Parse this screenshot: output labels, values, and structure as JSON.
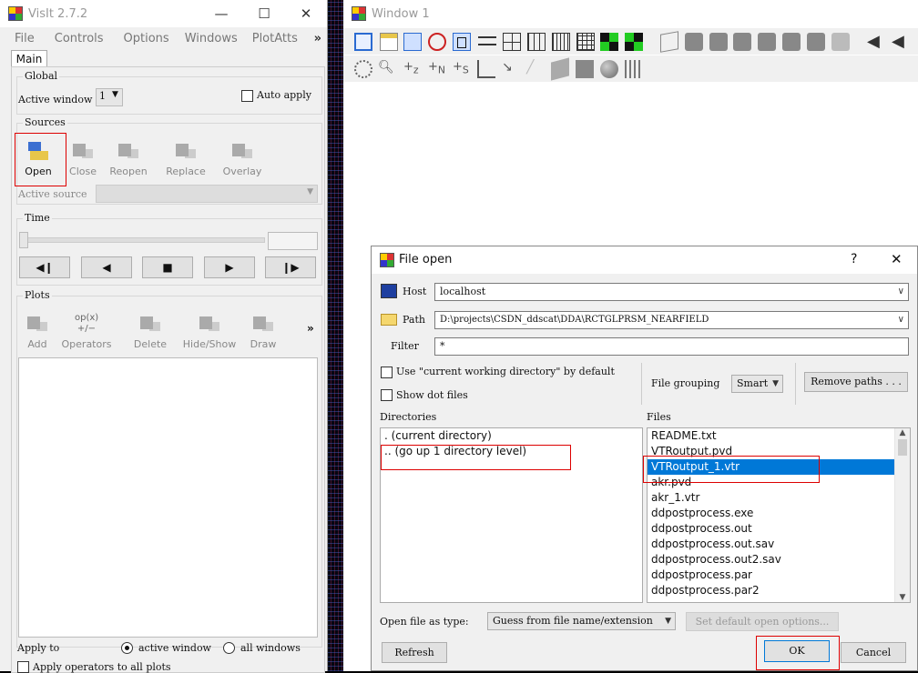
{
  "visit": {
    "title": "VisIt 2.7.2",
    "window_controls": {
      "minimize": "—",
      "maximize": "☐",
      "close": "✕"
    },
    "menu": [
      "File",
      "Controls",
      "Options",
      "Windows",
      "PlotAtts"
    ],
    "menu_more": "»",
    "tab": "Main",
    "global": {
      "title": "Global",
      "active_window_label": "Active window",
      "active_window_value": "1",
      "auto_apply_label": "Auto apply"
    },
    "sources": {
      "title": "Sources",
      "buttons": [
        "Open",
        "Close",
        "Reopen",
        "Replace",
        "Overlay"
      ],
      "active_source_label": "Active source"
    },
    "time": {
      "title": "Time",
      "buttons": [
        "◀❙",
        "◀",
        "■",
        "▶",
        "❙▶"
      ]
    },
    "plots": {
      "title": "Plots",
      "buttons": [
        "Add",
        "Operators",
        "Delete",
        "Hide/Show",
        "Draw"
      ],
      "more": "»"
    },
    "apply_to": {
      "label": "Apply to",
      "opt_active": "active window",
      "opt_all": "all windows",
      "apply_ops": "Apply operators to all plots"
    }
  },
  "window1": {
    "title": "Window 1"
  },
  "dialog": {
    "title": "File open",
    "help": "?",
    "close": "✕",
    "host_label": "Host",
    "host_value": "localhost",
    "path_label": "Path",
    "path_value": "D:\\projects\\CSDN_ddscat\\DDA\\RCTGLPRSM_NEARFIELD",
    "filter_label": "Filter",
    "filter_value": "*",
    "use_cwd_label": "Use \"current working directory\" by default",
    "show_dot_label": "Show dot files",
    "file_grouping_label": "File grouping",
    "file_grouping_value": "Smart",
    "remove_paths_label": "Remove paths . . .",
    "directories_label": "Directories",
    "directories": [
      ". (current directory)",
      ".. (go up 1 directory level)"
    ],
    "files_label": "Files",
    "files": [
      "README.txt",
      "VTRoutput.pvd",
      "VTRoutput_1.vtr",
      "akr.pvd",
      "akr_1.vtr",
      "ddpostprocess.exe",
      "ddpostprocess.out",
      "ddpostprocess.out.sav",
      "ddpostprocess.out2.sav",
      "ddpostprocess.par",
      "ddpostprocess.par2"
    ],
    "selected_file": "VTRoutput_1.vtr",
    "open_as_label": "Open file as type:",
    "open_as_value": "Guess from file name/extension",
    "set_default_label": "Set default open options...",
    "refresh_label": "Refresh",
    "ok_label": "OK",
    "cancel_label": "Cancel"
  }
}
